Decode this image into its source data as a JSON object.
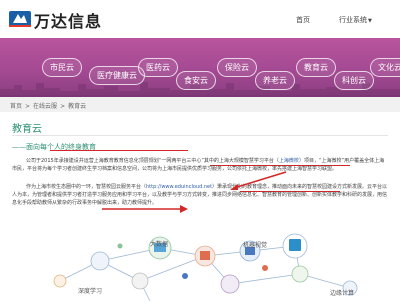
{
  "header": {
    "logo_text": "万达信息",
    "nav": {
      "home": "首页",
      "industry": "行业系统"
    }
  },
  "banner": {
    "clouds": [
      "市民云",
      "医疗健康云",
      "医药云",
      "食安云",
      "保险云",
      "养老云",
      "教育云",
      "科创云",
      "文化云"
    ]
  },
  "breadcrumb": {
    "items": [
      "首页",
      "在线云服",
      "教育云"
    ],
    "separator": ">"
  },
  "main": {
    "title": "教育云",
    "subtitle": "——面向每个人的终身教育",
    "para1_prefix": "公司于2015年承接建设并运营上海教育教育信息化顶层规划“一网两平台三中心”其中的上海大规模智慧学习平台（",
    "para1_link": "上海微校",
    "para1_suffix": "）项目，“上海微校”用户覆盖全体上海市民，平台将为每个学习者创建终生学习档案和信息空间，公司将为上海市民提供优质学习服务，公司依托上海微校，率先搭建上海智慧学习联盟。",
    "para2_prefix": "作为上海市校生态圈中的一环，智慧校园云服务平台（",
    "para2_link": "http://www.eduincloud.net",
    "para2_suffix": "）秉承现代化的教育理念，推动面向未来的智慧校园建设方式新发展。云平台以人为本，为管理者和提供学习者打造学习服务应用和学习平台，以及教学与学习方式转变，推进同步网络信息化、智慧教育的管理创新、创新实体教学和科研的发展，用信息化手段帮助教师从繁杂的行政事务中解脱出来，助力教师提升。"
  },
  "diagram": {
    "labels": [
      "大数据",
      "机器视觉",
      "深度学习",
      "边缘计算"
    ]
  },
  "colors": {
    "banner": "#a44a93",
    "accent": "#2a8f72",
    "annotation": "#d42727"
  }
}
